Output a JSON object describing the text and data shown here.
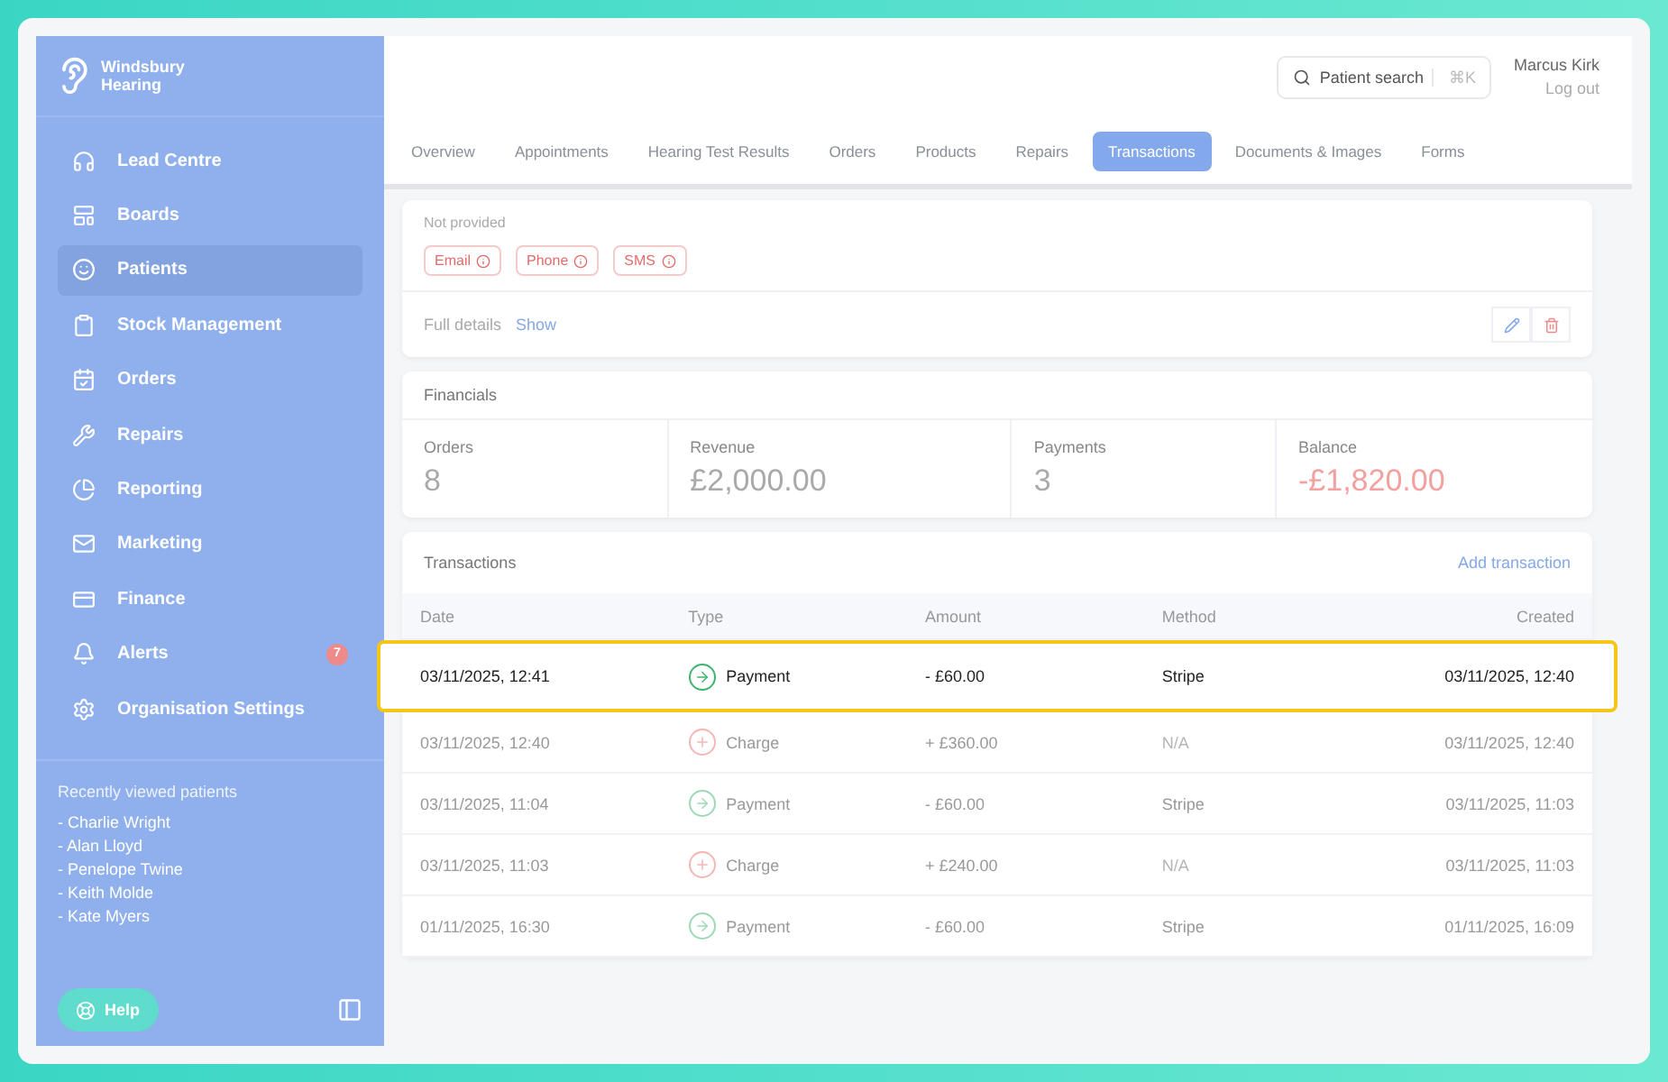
{
  "sidebar": {
    "brand": [
      "Windsbury",
      "Hearing"
    ],
    "items": [
      {
        "label": "Lead Centre",
        "selected": false
      },
      {
        "label": "Boards",
        "selected": false
      },
      {
        "label": "Patients",
        "selected": true
      },
      {
        "label": "Stock Management",
        "selected": false
      },
      {
        "label": "Orders",
        "selected": false
      },
      {
        "label": "Repairs",
        "selected": false
      },
      {
        "label": "Reporting",
        "selected": false
      },
      {
        "label": "Marketing",
        "selected": false
      },
      {
        "label": "Finance",
        "selected": false
      },
      {
        "label": "Alerts",
        "selected": false,
        "badge": "7"
      },
      {
        "label": "Organisation Settings",
        "selected": false
      }
    ],
    "recent_title": "Recently viewed patients",
    "recent": [
      "- Charlie Wright",
      "- Alan Lloyd",
      "- Penelope Twine",
      "- Keith Molde",
      "- Kate Myers"
    ],
    "help": "Help"
  },
  "header": {
    "search": {
      "placeholder": "Patient search",
      "shortcut": "⌘K"
    },
    "user": "Marcus Kirk",
    "logout": "Log out"
  },
  "tabs": [
    {
      "label": "Overview",
      "selected": false
    },
    {
      "label": "Appointments",
      "selected": false
    },
    {
      "label": "Hearing Test Results",
      "selected": false
    },
    {
      "label": "Orders",
      "selected": false
    },
    {
      "label": "Products",
      "selected": false
    },
    {
      "label": "Repairs",
      "selected": false
    },
    {
      "label": "Transactions",
      "selected": true
    },
    {
      "label": "Documents & Images",
      "selected": false
    },
    {
      "label": "Forms",
      "selected": false
    }
  ],
  "contact": {
    "address": "Not provided",
    "tags": [
      "Email",
      "Phone",
      "SMS"
    ],
    "details_label": "Full details",
    "details_link": "Show"
  },
  "financials": {
    "title": "Financials",
    "stats": [
      {
        "label": "Orders",
        "value": "8",
        "negative": false
      },
      {
        "label": "Revenue",
        "value": "£2,000.00",
        "negative": false
      },
      {
        "label": "Payments",
        "value": "3",
        "negative": false
      },
      {
        "label": "Balance",
        "value": "-£1,820.00",
        "negative": true
      }
    ]
  },
  "transactions": {
    "title": "Transactions",
    "add_link": "Add transaction",
    "columns": [
      "Date",
      "Type",
      "Amount",
      "Method",
      "Created"
    ],
    "rows": [
      {
        "date": "03/11/2025, 12:41",
        "kind": "payment",
        "type": "Payment",
        "amount": "- £60.00",
        "method": "Stripe",
        "created": "03/11/2025, 12:40",
        "highlighted": true
      },
      {
        "date": "03/11/2025, 12:40",
        "kind": "charge",
        "type": "Charge",
        "amount": "+ £360.00",
        "method": "N/A",
        "created": "03/11/2025, 12:40",
        "highlighted": false
      },
      {
        "date": "03/11/2025, 11:04",
        "kind": "payment",
        "type": "Payment",
        "amount": "- £60.00",
        "method": "Stripe",
        "created": "03/11/2025, 11:03",
        "highlighted": false
      },
      {
        "date": "03/11/2025, 11:03",
        "kind": "charge",
        "type": "Charge",
        "amount": "+ £240.00",
        "method": "N/A",
        "created": "03/11/2025, 11:03",
        "highlighted": false
      },
      {
        "date": "01/11/2025, 16:30",
        "kind": "payment",
        "type": "Payment",
        "amount": "- £60.00",
        "method": "Stripe",
        "created": "01/11/2025, 16:09",
        "highlighted": false
      }
    ]
  }
}
